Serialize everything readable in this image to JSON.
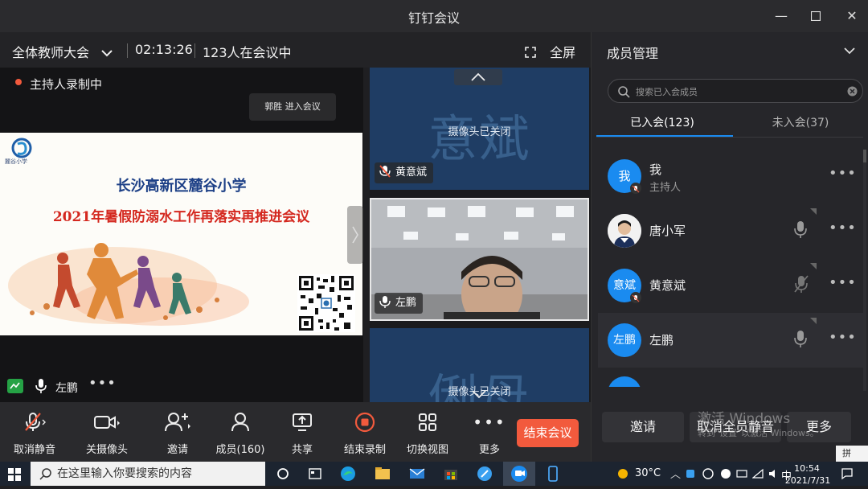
{
  "app": {
    "title": "钉钉会议"
  },
  "meeting": {
    "name": "全体教师大会",
    "duration": "02:13:26",
    "participants_text": "123人在会议中",
    "fullscreen_label": "全屏",
    "recording_label": "主持人录制中",
    "join_toast": "郭胜 进入会议"
  },
  "slide": {
    "school_logo_text": "麓谷小学",
    "line1": "长沙高新区麓谷小学",
    "line2": "2021年暑假防溺水工作再落实再推进会议"
  },
  "stage_footer": {
    "speaker_name": "左鹏"
  },
  "tiles": [
    {
      "big_name": "意斌",
      "status": "摄像头已关闭",
      "tag": "黄意斌"
    },
    {
      "tag": "左鹏"
    },
    {
      "big_name": "俐母",
      "status": "摄像头已关闭"
    }
  ],
  "toolbar": {
    "mute": "取消静音",
    "camera": "关摄像头",
    "invite": "邀请",
    "members": "成员(160)",
    "share": "共享",
    "end_record": "结束录制",
    "switch_view": "切换视图",
    "more": "更多",
    "end_meeting": "结束会议"
  },
  "panel": {
    "title": "成员管理",
    "search_placeholder": "搜索已入会成员",
    "tab_joined": "已入会(123)",
    "tab_not_joined": "未入会(37)",
    "members": [
      {
        "avatar": "我",
        "name": "我",
        "role": "主持人"
      },
      {
        "avatar": "",
        "name": "唐小军"
      },
      {
        "avatar": "意斌",
        "name": "黄意斌"
      },
      {
        "avatar": "左鹏",
        "name": "左鹏"
      }
    ],
    "btn_invite": "邀请",
    "btn_mute_all": "取消全员静音",
    "btn_more": "更多",
    "watermark_line1": "激活 Windows",
    "watermark_line2": "转到\"设置\"以激活 Windows。"
  },
  "taskbar": {
    "search_placeholder": "在这里输入你要搜索的内容",
    "weather": "30°C",
    "time": "10:54",
    "date": "2021/7/31",
    "ime": "拼"
  },
  "colors": {
    "accent": "#1a8bf0",
    "end": "#f25a3d",
    "record": "#f25a3d"
  }
}
